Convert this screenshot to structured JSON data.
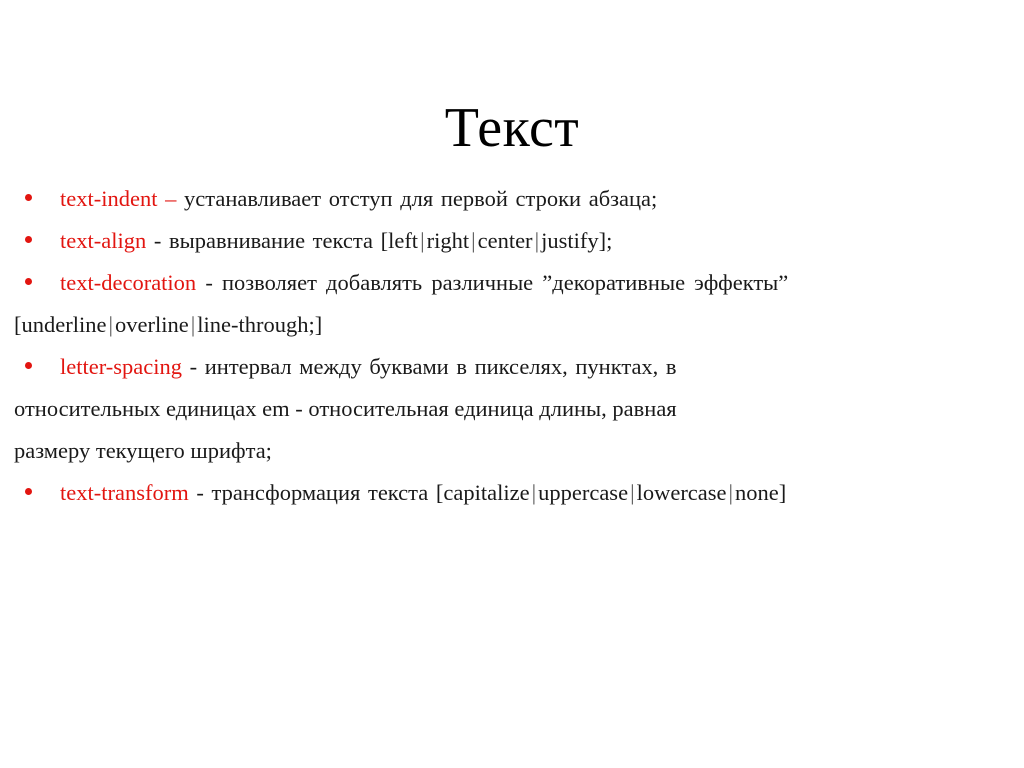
{
  "slide": {
    "title": "Текст",
    "background_color": "#FFFFFF",
    "accent_color": "#E21510",
    "text_color": "#000000",
    "separator_color": "#5A5A5A",
    "bullet_glyph": "•"
  },
  "bullets": [
    {
      "keyword": "text-indent",
      "dash": "–",
      "dash_is_accent": true,
      "description": "устанавливает отступ для первой строки абзаца;",
      "values_line": ""
    },
    {
      "keyword": "text-align",
      "dash": "-",
      "dash_is_accent": false,
      "description": "выравнивание текста",
      "values_prefix": "[",
      "values": [
        "left",
        "right",
        "center",
        "justify"
      ],
      "values_suffix": "];"
    },
    {
      "keyword": "text-decoration",
      "dash": "-",
      "dash_is_accent": false,
      "description": "позволяет добавлять различные ”декоративные эффекты”",
      "values_prefix": "[",
      "values": [
        "underline",
        "overline",
        "line-through;"
      ],
      "values_suffix": "]"
    },
    {
      "keyword": "letter-spacing",
      "dash": "-",
      "dash_is_accent": false,
      "description_line1": "интервал между буквами в пикселях, пунктах, в",
      "description_line2": "относительных единицах em - относительная единица длины, равная",
      "description_line3": "размеру текущего шрифта;"
    },
    {
      "keyword": "text-transform",
      "dash": "-",
      "dash_is_accent": false,
      "description": "трансформация текста",
      "values_prefix": "[",
      "values": [
        "capitalize",
        "uppercase",
        "lowercase",
        "none"
      ],
      "values_suffix": "]"
    }
  ]
}
